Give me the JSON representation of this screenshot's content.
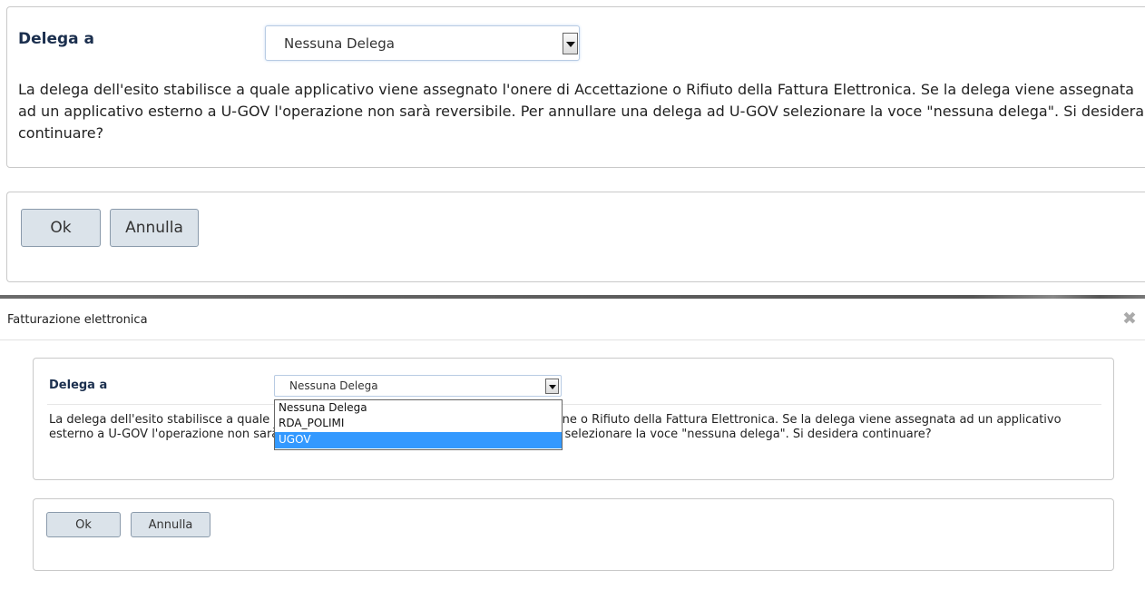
{
  "form": {
    "delega_label": "Delega a",
    "select_value": "Nessuna Delega",
    "zoom_paragraph": "La delega dell'esito stabilisce a quale applicativo viene assegnato l'onere di Accettazione o Rifiuto della Fattura Elettronica. Se la delega viene assegnata ad un applicativo esterno a U-GOV l'operazione non sarà reversibile. Per annullare una delega ad U-GOV selezionare la voce \"nessuna delega\". Si desidera continuare?",
    "dialog_paragraph": "La delega dell'esito stabilisce a quale applicativo viene assegnato l'onere di Accettazione o Rifiuto della Fattura Elettronica. Se la delega viene assegnata ad un applicativo esterno a U-GOV l'operazione non sarà reversibile. Per annullare una delega ad U-GOV selezionare la voce \"nessuna delega\". Si desidera continuare?",
    "ok_label": "Ok",
    "annulla_label": "Annulla"
  },
  "dialog": {
    "title": "Fatturazione elettronica",
    "close_icon": "close-icon"
  },
  "dropdown": {
    "options": [
      "Nessuna Delega",
      "RDA_POLIMI",
      "UGOV"
    ],
    "highlighted": "UGOV"
  },
  "colors": {
    "highlight": "#3399ff",
    "label": "#1b2f4e",
    "button_bg": "#dbe3ea"
  }
}
